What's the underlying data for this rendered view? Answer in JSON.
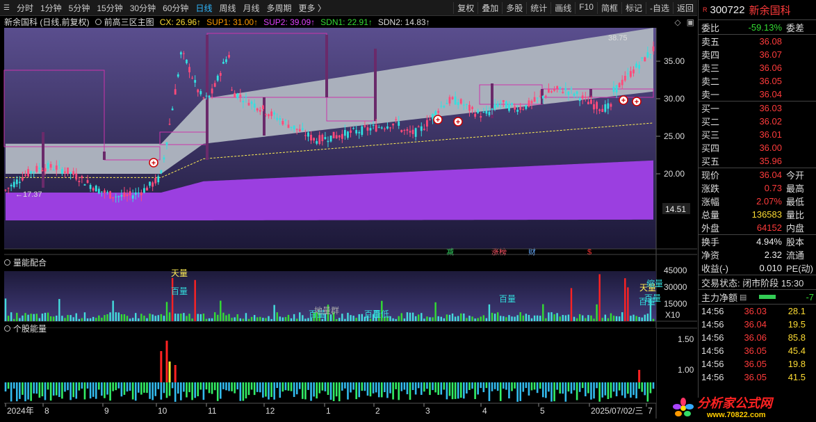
{
  "toolbar": {
    "left": [
      "分时",
      "1分钟",
      "5分钟",
      "15分钟",
      "30分钟",
      "60分钟",
      "日线",
      "周线",
      "月线",
      "多周期",
      "更多 〉"
    ],
    "active": "日线",
    "right": [
      "复权",
      "叠加",
      "多股",
      "统计",
      "画线",
      "F10",
      "简框",
      "标记",
      "-自选",
      "返回"
    ]
  },
  "infobar": {
    "stock": "新余国科 (日线,前复权)",
    "indicator": "前高三区主图",
    "cx": "CX: 26.96↑",
    "sup1": "SUP1: 31.00↑",
    "sup2": "SUP2: 39.09↑",
    "sdn1": "SDN1: 22.91↑",
    "sdn2": "SDN2: 14.83↑"
  },
  "main_chart": {
    "axis_ticks": [
      "35.00",
      "30.00",
      "25.00",
      "20.00"
    ],
    "current_label": "14.51",
    "high_label": "38.75",
    "low_label": "←17.37",
    "markers": [
      "减",
      "涨榜",
      "财",
      "$"
    ]
  },
  "volume_panel": {
    "title": "量能配合",
    "axis_ticks": [
      "45000",
      "30000",
      "15000"
    ],
    "unit": "X10",
    "labels": [
      "天量",
      "百量",
      "百量",
      "百量",
      "天量",
      "百量",
      "百量",
      "百量",
      "百低",
      "地量群",
      "缩量"
    ]
  },
  "energy_panel": {
    "title": "个股能量",
    "axis_ticks": [
      "1.50",
      "1.00"
    ]
  },
  "dates": [
    "2024年",
    "8",
    "9",
    "10",
    "11",
    "12",
    "1",
    "2",
    "3",
    "4",
    "5",
    "2025/07/02/三",
    "7"
  ],
  "right_panel": {
    "badge": "R",
    "code": "300722",
    "name": "新余国科",
    "weibi_label": "委比",
    "weibi": "-59.13%",
    "weicha_label": "委差",
    "sell": [
      {
        "label": "卖五",
        "price": "36.08"
      },
      {
        "label": "卖四",
        "price": "36.07"
      },
      {
        "label": "卖三",
        "price": "36.06"
      },
      {
        "label": "卖二",
        "price": "36.05"
      },
      {
        "label": "卖一",
        "price": "36.04"
      }
    ],
    "buy": [
      {
        "label": "买一",
        "price": "36.03"
      },
      {
        "label": "买二",
        "price": "36.02"
      },
      {
        "label": "买三",
        "price": "36.01"
      },
      {
        "label": "买四",
        "price": "36.00"
      },
      {
        "label": "买五",
        "price": "35.96"
      }
    ],
    "stats": [
      {
        "l": "现价",
        "v": "36.04",
        "r": "今开",
        "c": "red"
      },
      {
        "l": "涨跌",
        "v": "0.73",
        "r": "最高",
        "c": "red"
      },
      {
        "l": "涨幅",
        "v": "2.07%",
        "r": "最低",
        "c": "red"
      },
      {
        "l": "总量",
        "v": "136583",
        "r": "量比",
        "c": "yellow"
      },
      {
        "l": "外盘",
        "v": "64152",
        "r": "内盘",
        "c": "red"
      }
    ],
    "stats2": [
      {
        "l": "换手",
        "v": "4.94%",
        "r": "股本",
        "c": "white"
      },
      {
        "l": "净资",
        "v": "2.32",
        "r": "流通",
        "c": "white"
      },
      {
        "l": "收益(-)",
        "v": "0.010",
        "r": "PE(动)",
        "c": "white"
      }
    ],
    "trade_status": "交易状态: 闭市阶段 15:30",
    "net_inflow_label": "主力净额",
    "net_inflow_value": "-7",
    "ticks": [
      {
        "t": "14:56",
        "p": "36.03",
        "v": "28.1"
      },
      {
        "t": "14:56",
        "p": "36.04",
        "v": "19.5"
      },
      {
        "t": "14:56",
        "p": "36.06",
        "v": "85.8"
      },
      {
        "t": "14:56",
        "p": "36.05",
        "v": "45.4"
      },
      {
        "t": "14:56",
        "p": "36.05",
        "v": "19.8"
      },
      {
        "t": "14:56",
        "p": "36.05",
        "v": "41.5"
      }
    ]
  },
  "logo": {
    "text": "分析家公式网",
    "url": "www.70822.com"
  }
}
